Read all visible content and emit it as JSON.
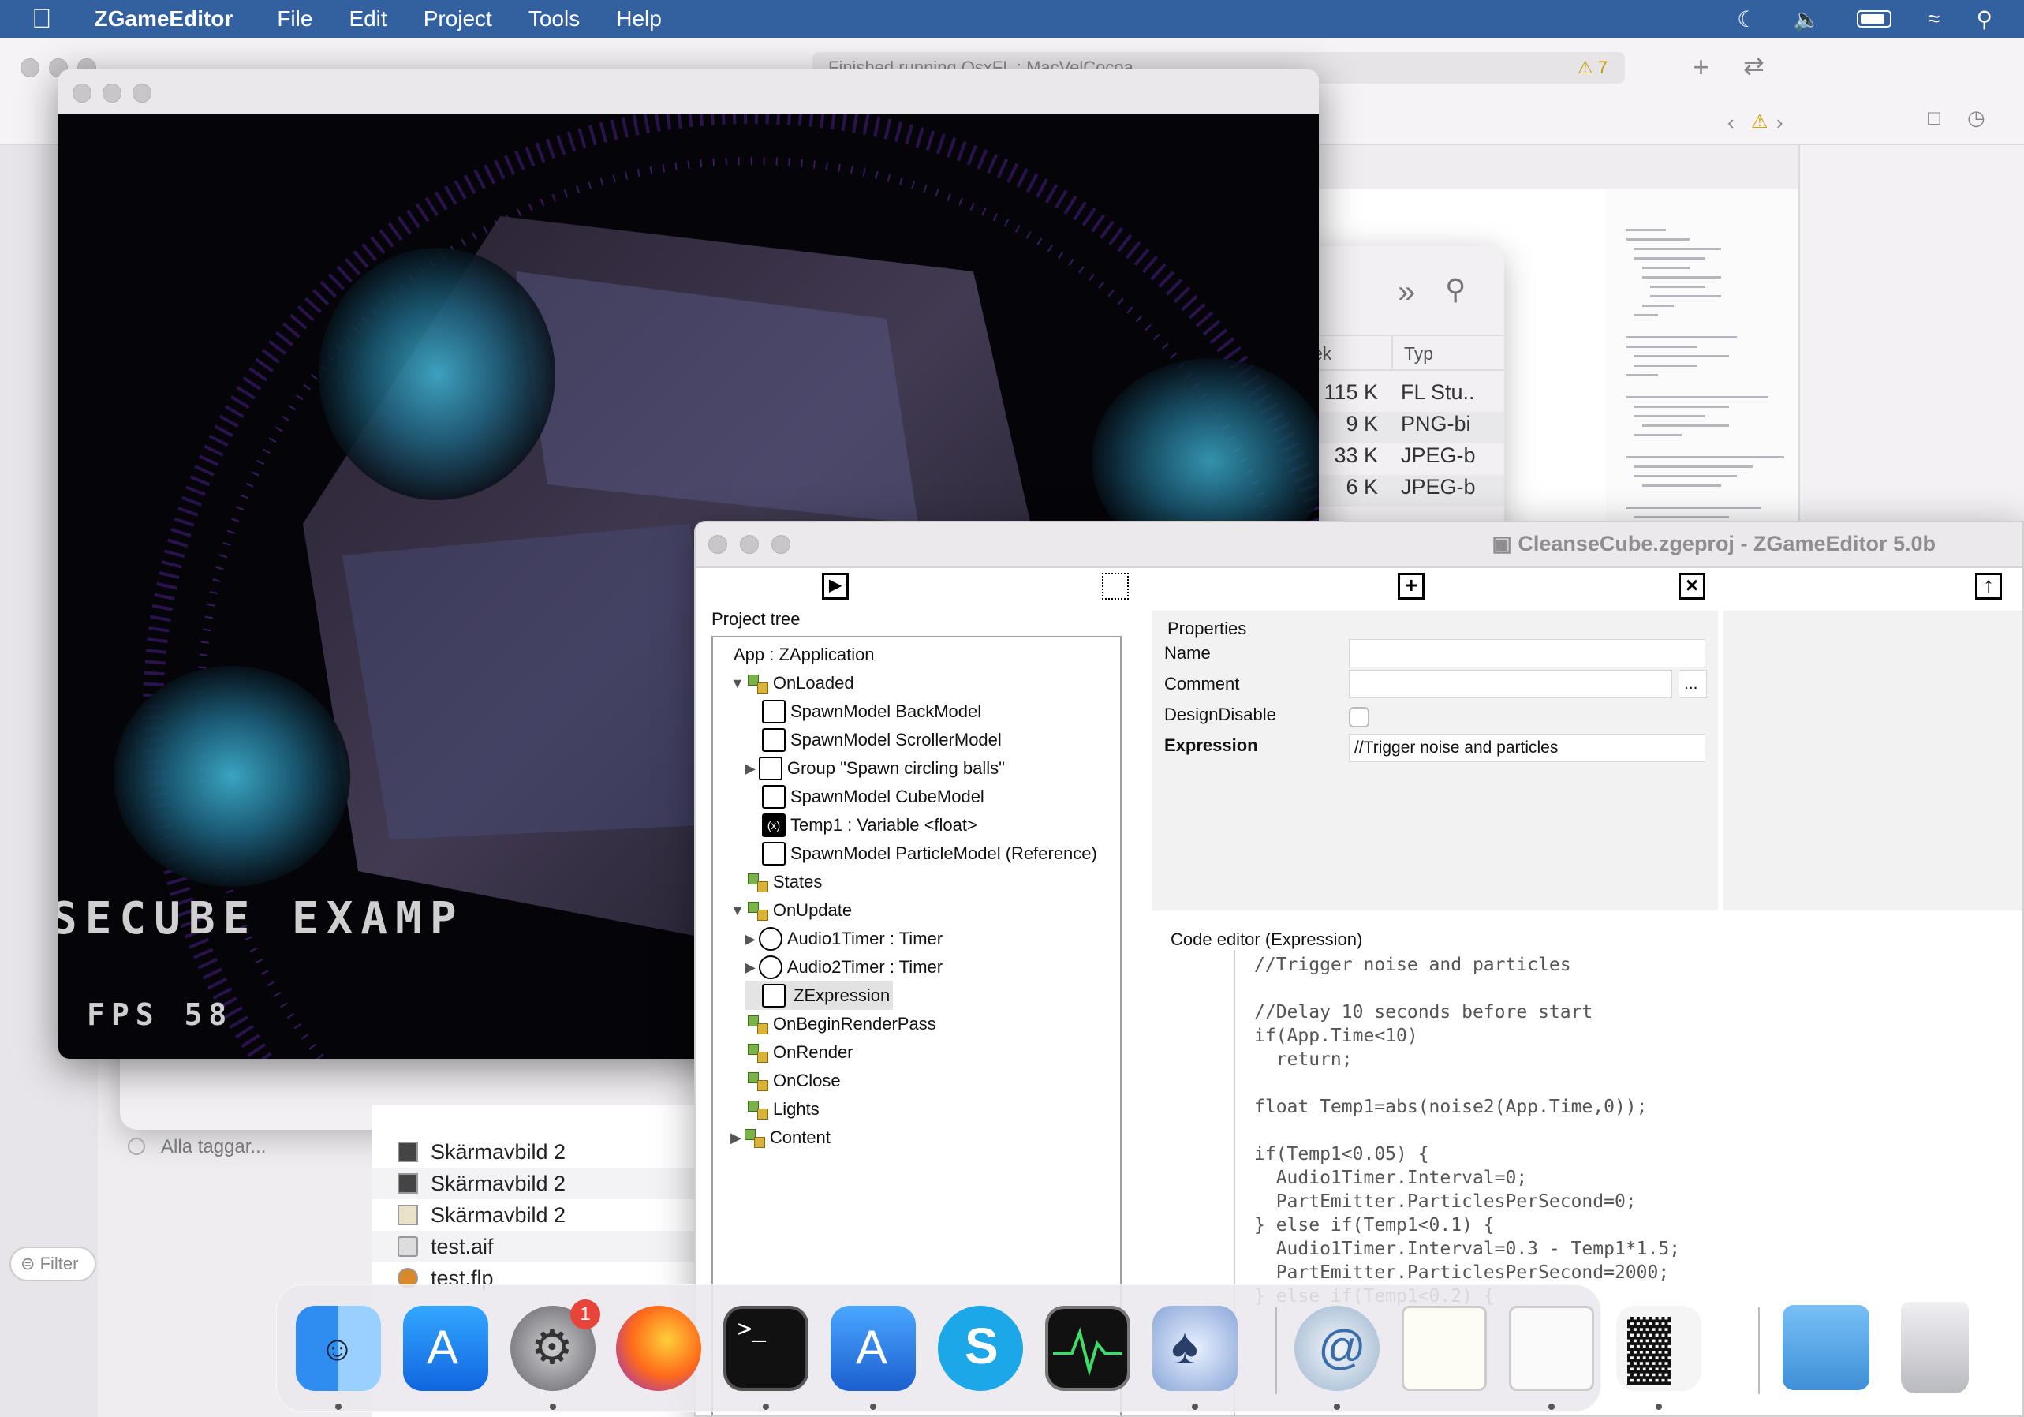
{
  "menubar": {
    "app_name": "ZGameEditor",
    "items": [
      "File",
      "Edit",
      "Project",
      "Tools",
      "Help"
    ]
  },
  "xcode": {
    "status": "Finished running OsxFL : MacVelCocoa",
    "warnings": "7"
  },
  "finder": {
    "column_kind": "Typ",
    "column_size_partial": "ek",
    "rows": [
      {
        "size": "115 K",
        "kind": "FL Stu.."
      },
      {
        "size": "9 K",
        "kind": "PNG-bi"
      },
      {
        "size": "33 K",
        "kind": "JPEG-b"
      },
      {
        "size": "6 K",
        "kind": "JPEG-b"
      }
    ],
    "tags": "Alla taggar...",
    "filter": "Filter",
    "files": [
      "Skärmavbild 2",
      "Skärmavbild 2",
      "Skärmavbild 2",
      "test.aif",
      "test.flp"
    ]
  },
  "game": {
    "overlay_text": "SECUBE EXAMP",
    "fps_label": "FPS",
    "fps_value": "58"
  },
  "zge": {
    "title": "CleanseCube.zgeproj - ZGameEditor 5.0b",
    "project_tree_label": "Project tree",
    "tree": [
      {
        "label": "App : ZApplication",
        "depth": 0,
        "icon": "none"
      },
      {
        "label": "OnLoaded",
        "depth": 1,
        "icon": "group",
        "expanded": true
      },
      {
        "label": "SpawnModel  BackModel",
        "depth": 2,
        "icon": "model"
      },
      {
        "label": "SpawnModel  ScrollerModel",
        "depth": 2,
        "icon": "model"
      },
      {
        "label": "Group \"Spawn circling balls\"",
        "depth": 2,
        "icon": "folder",
        "collapsed": true
      },
      {
        "label": "SpawnModel  CubeModel",
        "depth": 2,
        "icon": "model"
      },
      {
        "label": "Temp1 : Variable <float>",
        "depth": 2,
        "icon": "variable"
      },
      {
        "label": "SpawnModel  ParticleModel (Reference)",
        "depth": 2,
        "icon": "model"
      },
      {
        "label": "States",
        "depth": 1,
        "icon": "group"
      },
      {
        "label": "OnUpdate",
        "depth": 1,
        "icon": "group",
        "expanded": true
      },
      {
        "label": "Audio1Timer : Timer",
        "depth": 2,
        "icon": "timer",
        "collapsed": true
      },
      {
        "label": "Audio2Timer : Timer",
        "depth": 2,
        "icon": "timer",
        "collapsed": true
      },
      {
        "label": "ZExpression",
        "depth": 2,
        "icon": "expression",
        "selected": true
      },
      {
        "label": "OnBeginRenderPass",
        "depth": 1,
        "icon": "group"
      },
      {
        "label": "OnRender",
        "depth": 1,
        "icon": "group"
      },
      {
        "label": "OnClose",
        "depth": 1,
        "icon": "group"
      },
      {
        "label": "Lights",
        "depth": 1,
        "icon": "group"
      },
      {
        "label": "Content",
        "depth": 1,
        "icon": "group",
        "collapsed": true
      }
    ],
    "properties_label": "Properties",
    "props": {
      "name_label": "Name",
      "name_value": "",
      "comment_label": "Comment",
      "comment_value": "",
      "comment_button": "...",
      "designdisable_label": "DesignDisable",
      "expression_label": "Expression",
      "expression_value": "//Trigger noise and particles"
    },
    "code_editor_label": "Code editor (Expression)",
    "code": "//Trigger noise and particles\n\n//Delay 10 seconds before start\nif(App.Time<10)\n  return;\n\nfloat Temp1=abs(noise2(App.Time,0));\n\nif(Temp1<0.05) {\n  Audio1Timer.Interval=0;\n  PartEmitter.ParticlesPerSecond=0;\n} else if(Temp1<0.1) {\n  Audio1Timer.Interval=0.3 - Temp1*1.5;\n  PartEmitter.ParticlesPerSecond=2000;\n} else if(Temp1<0.2) {"
  },
  "dock": {
    "settings_badge": "1"
  }
}
